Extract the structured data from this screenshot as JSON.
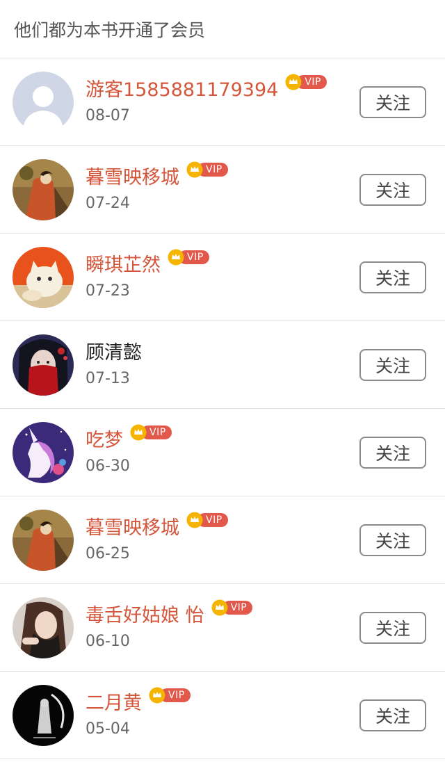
{
  "header": {
    "title": "他们都为本书开通了会员"
  },
  "vip_badge_label": "VIP",
  "colors": {
    "vip_name": "#d4553a",
    "vip_pill": "#e2584a",
    "crown": "#f4b400"
  },
  "members": [
    {
      "name": "游客1585881179394",
      "date": "08-07",
      "vip": true,
      "follow_label": "关注",
      "avatar": "default-silhouette"
    },
    {
      "name": "暮雪映移城",
      "date": "07-24",
      "vip": true,
      "follow_label": "关注",
      "avatar": "painting-lady"
    },
    {
      "name": "瞬琪芷然",
      "date": "07-23",
      "vip": true,
      "follow_label": "关注",
      "avatar": "cat-orange"
    },
    {
      "name": "顾清懿",
      "date": "07-13",
      "vip": false,
      "follow_label": "关注",
      "avatar": "veiled-girl"
    },
    {
      "name": "吃梦",
      "date": "06-30",
      "vip": true,
      "follow_label": "关注",
      "avatar": "unicorn"
    },
    {
      "name": "暮雪映移城",
      "date": "06-25",
      "vip": true,
      "follow_label": "关注",
      "avatar": "painting-lady"
    },
    {
      "name": "毒舌好姑娘 怡",
      "date": "06-10",
      "vip": true,
      "follow_label": "关注",
      "avatar": "girl-photo"
    },
    {
      "name": "二月黄",
      "date": "05-04",
      "vip": true,
      "follow_label": "关注",
      "avatar": "dark-figure"
    }
  ]
}
